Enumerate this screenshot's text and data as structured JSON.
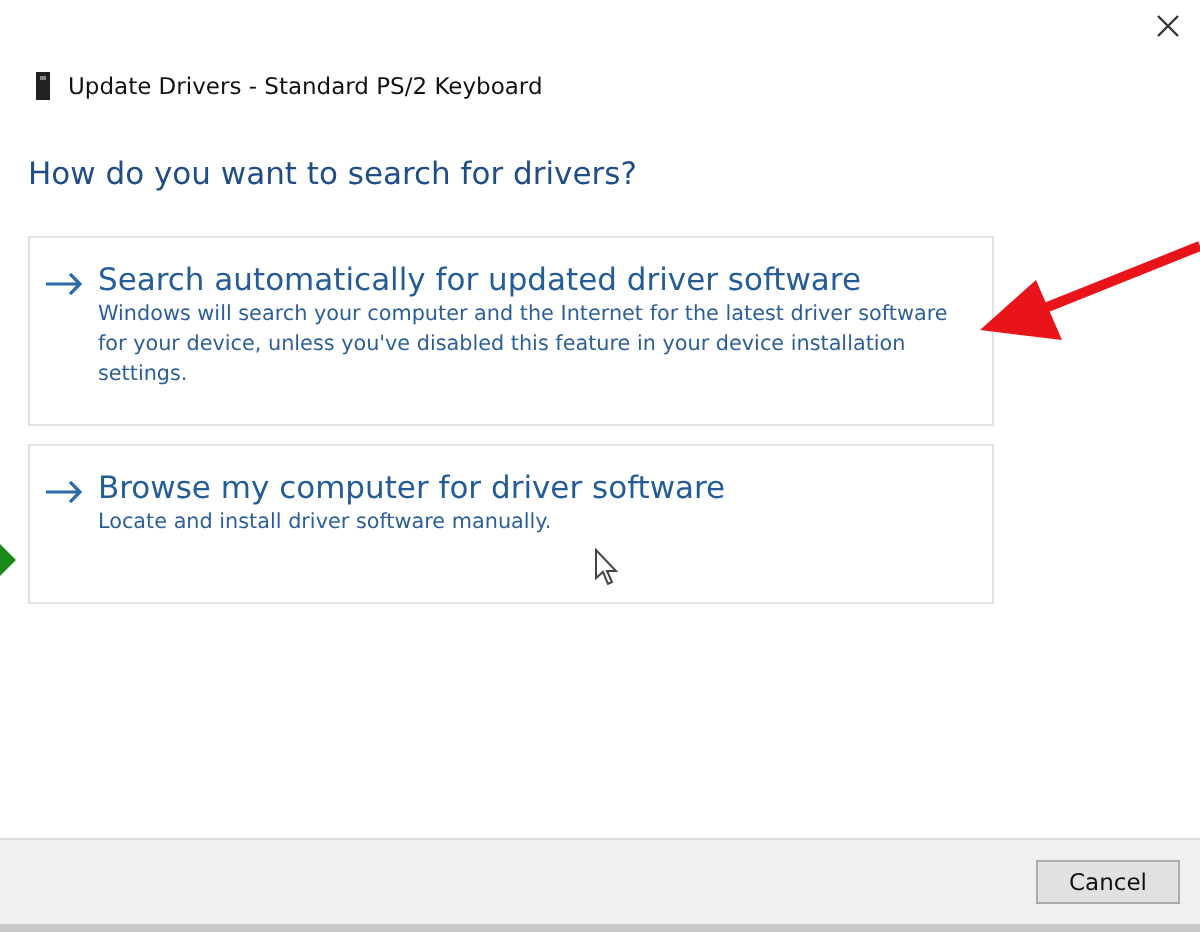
{
  "window": {
    "title": "Update Drivers - Standard PS/2 Keyboard"
  },
  "heading": "How do you want to search for drivers?",
  "options": [
    {
      "title": "Search automatically for updated driver software",
      "description": "Windows will search your computer and the Internet for the latest driver software for your device, unless you've disabled this feature in your device installation settings."
    },
    {
      "title": "Browse my computer for driver software",
      "description": "Locate and install driver software manually."
    }
  ],
  "buttons": [
    "Cancel"
  ]
}
